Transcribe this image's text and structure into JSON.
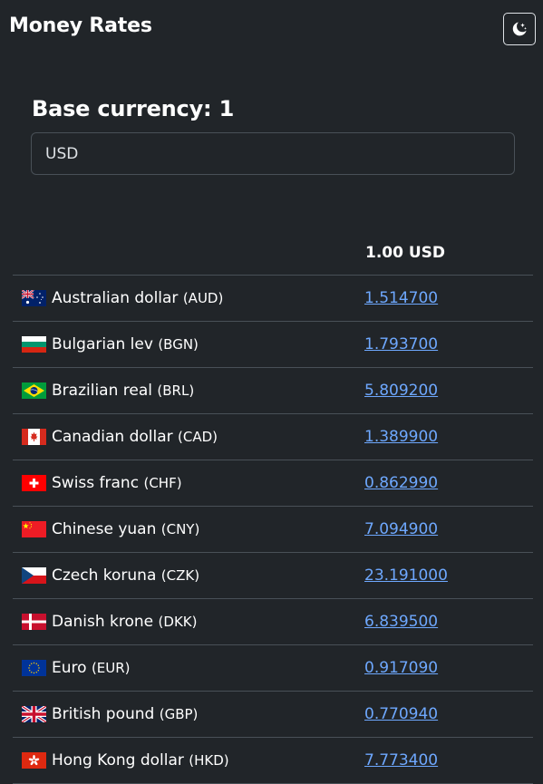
{
  "app": {
    "title": "Money Rates",
    "theme_toggle_icon": "moon-stars-icon"
  },
  "base": {
    "label": "Base currency: 1",
    "value": "USD"
  },
  "table": {
    "header_value": "1.00 USD",
    "rows": [
      {
        "flag": "flag-au-icon",
        "name": "Australian dollar",
        "code": "(AUD)",
        "rate": "1.514700"
      },
      {
        "flag": "flag-bg-icon",
        "name": "Bulgarian lev",
        "code": "(BGN)",
        "rate": "1.793700"
      },
      {
        "flag": "flag-br-icon",
        "name": "Brazilian real",
        "code": "(BRL)",
        "rate": "5.809200"
      },
      {
        "flag": "flag-ca-icon",
        "name": "Canadian dollar",
        "code": "(CAD)",
        "rate": "1.389900"
      },
      {
        "flag": "flag-ch-icon",
        "name": "Swiss franc",
        "code": "(CHF)",
        "rate": "0.862990"
      },
      {
        "flag": "flag-cn-icon",
        "name": "Chinese yuan",
        "code": "(CNY)",
        "rate": "7.094900"
      },
      {
        "flag": "flag-cz-icon",
        "name": "Czech koruna",
        "code": "(CZK)",
        "rate": "23.191000"
      },
      {
        "flag": "flag-dk-icon",
        "name": "Danish krone",
        "code": "(DKK)",
        "rate": "6.839500"
      },
      {
        "flag": "flag-eu-icon",
        "name": "Euro",
        "code": "(EUR)",
        "rate": "0.917090"
      },
      {
        "flag": "flag-gb-icon",
        "name": "British pound",
        "code": "(GBP)",
        "rate": "0.770940"
      },
      {
        "flag": "flag-hk-icon",
        "name": "Hong Kong dollar",
        "code": "(HKD)",
        "rate": "7.773400"
      }
    ]
  }
}
